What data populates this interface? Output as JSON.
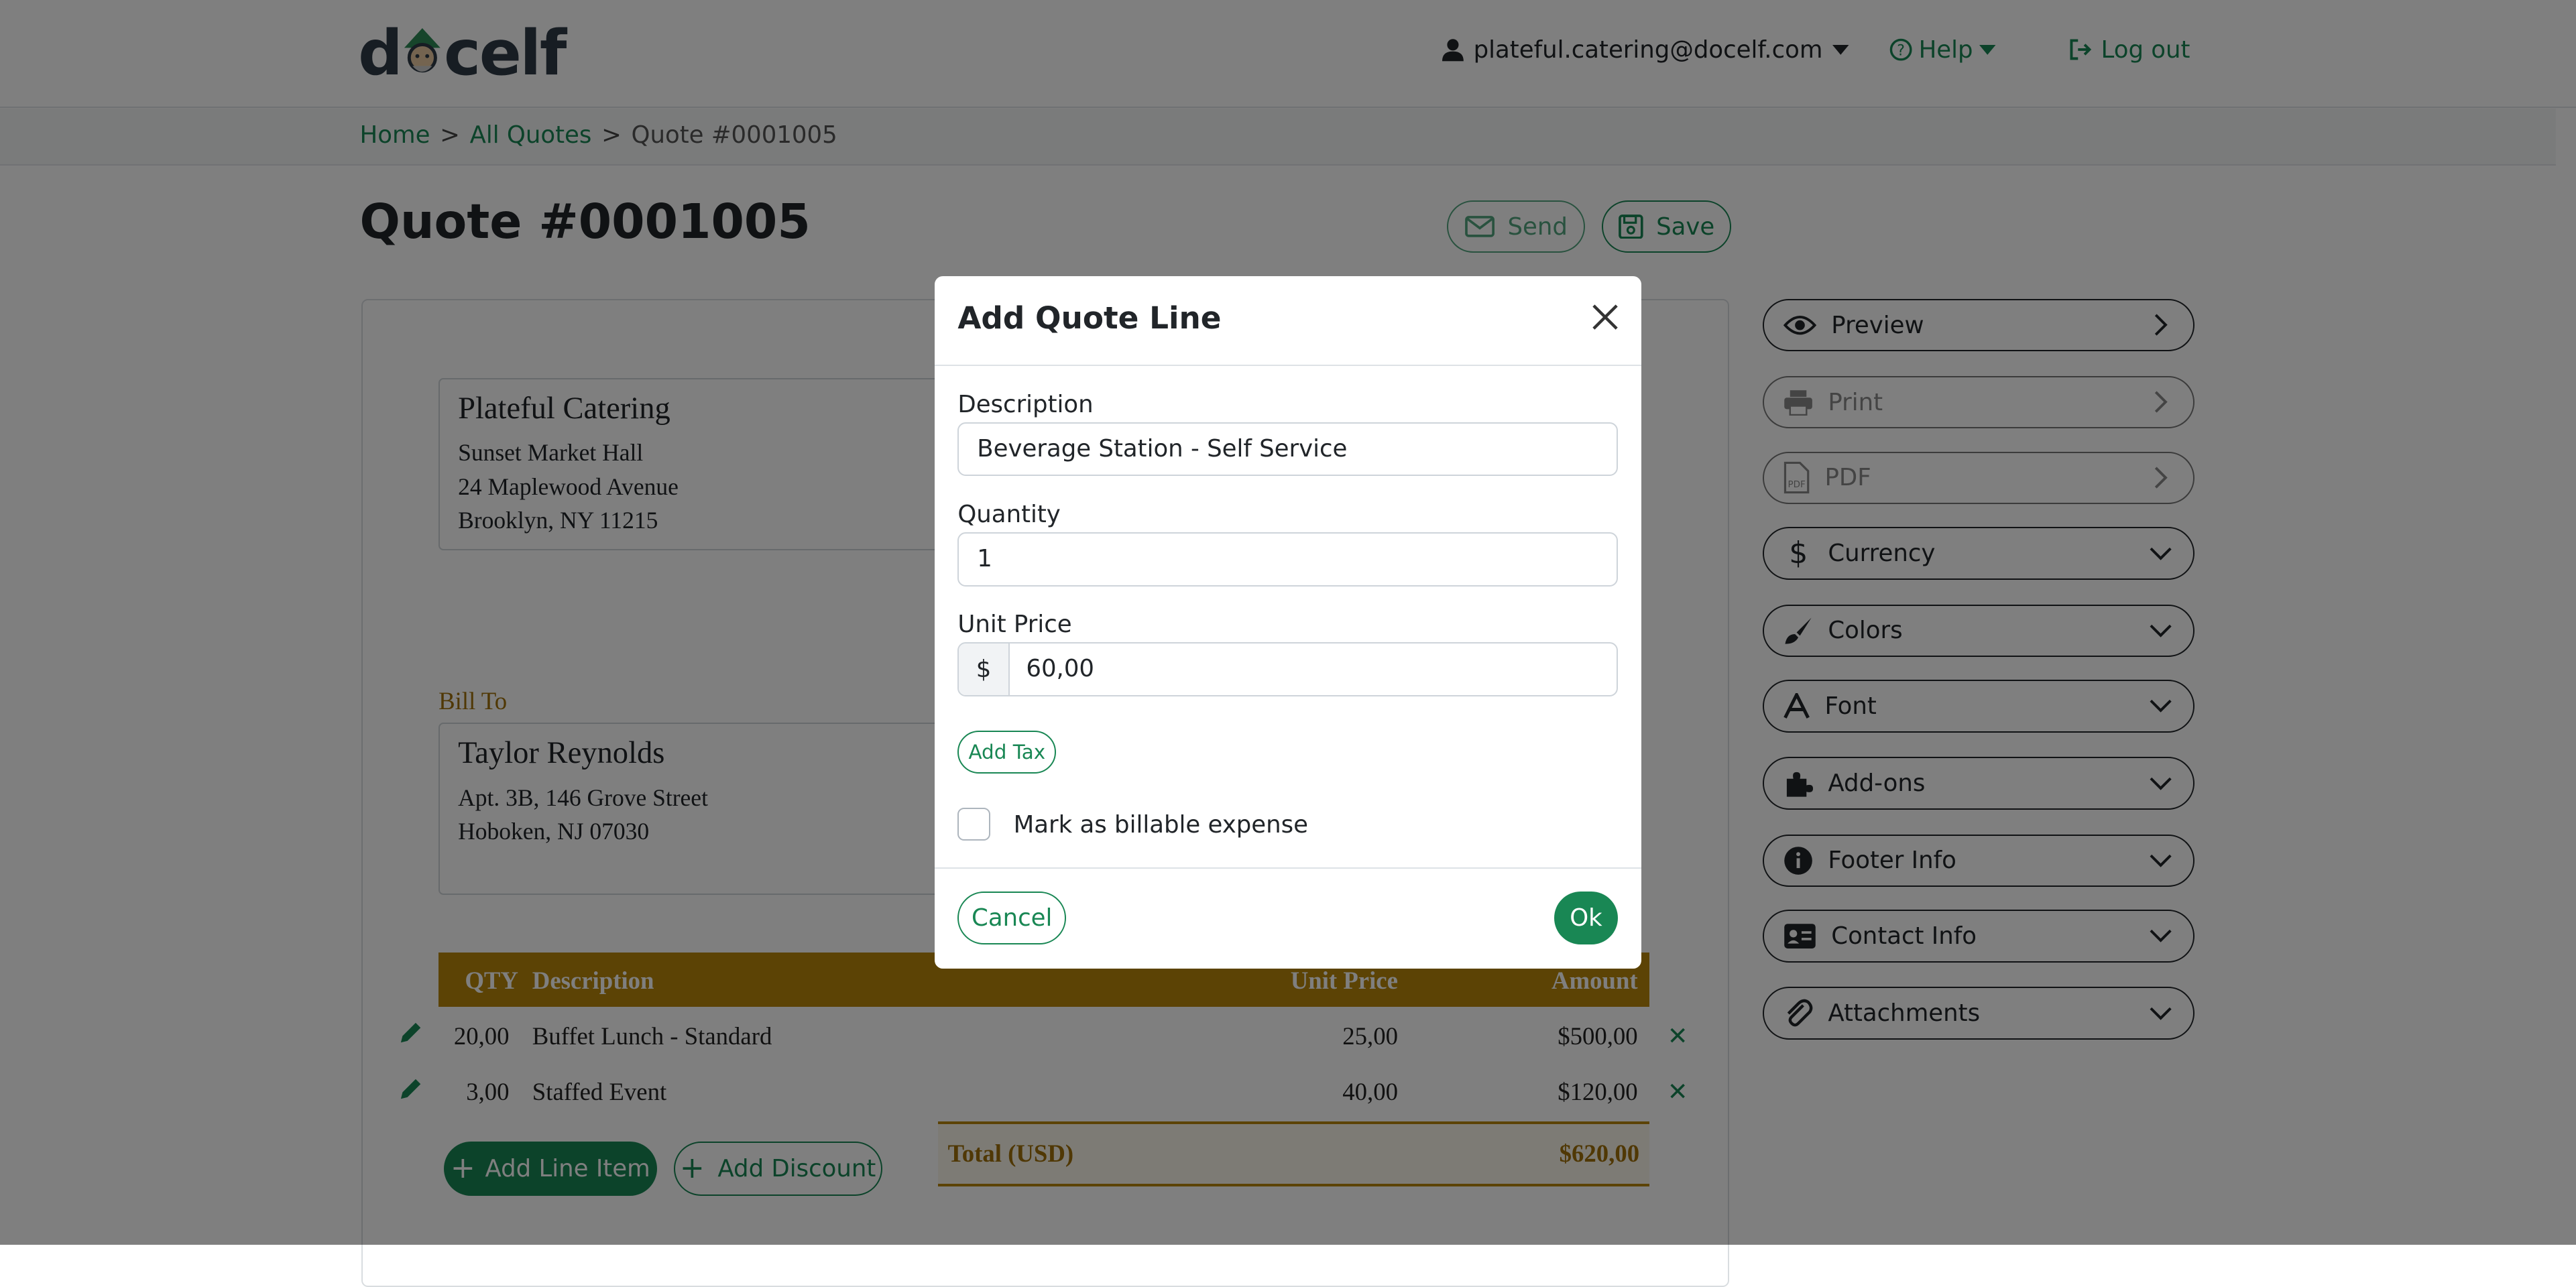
{
  "header": {
    "logo": "docelf",
    "user_email": "plateful.catering@docelf.com",
    "help": "Help",
    "logout": "Log out"
  },
  "breadcrumb": {
    "home": "Home",
    "all_quotes": "All Quotes",
    "current": "Quote #0001005",
    "sep": ">"
  },
  "page": {
    "title": "Quote #0001005",
    "send": "Send",
    "save": "Save"
  },
  "sender": {
    "name": "Plateful Catering",
    "lines": [
      "Sunset Market Hall",
      "24 Maplewood Avenue",
      "Brooklyn, NY 11215"
    ]
  },
  "bill_to": {
    "label": "Bill To",
    "name": "Taylor Reynolds",
    "lines": [
      "Apt. 3B, 146 Grove Street",
      "Hoboken, NJ 07030"
    ]
  },
  "table": {
    "headers": {
      "qty": "QTY",
      "description": "Description",
      "unit_price": "Unit Price",
      "amount": "Amount"
    },
    "rows": [
      {
        "qty": "20,00",
        "description": "Buffet Lunch - Standard",
        "unit_price": "25,00",
        "amount": "$500,00"
      },
      {
        "qty": "3,00",
        "description": "Staffed Event",
        "unit_price": "40,00",
        "amount": "$120,00"
      }
    ],
    "add_line_item": "Add Line Item",
    "add_discount": "Add Discount",
    "total_label": "Total (USD)",
    "total_value": "$620,00"
  },
  "sidebar": {
    "items": [
      {
        "label": "Preview",
        "icon": "eye-icon"
      },
      {
        "label": "Print",
        "icon": "printer-icon"
      },
      {
        "label": "PDF",
        "icon": "pdf-icon"
      },
      {
        "label": "Currency",
        "icon": "dollar-icon"
      },
      {
        "label": "Colors",
        "icon": "brush-icon"
      },
      {
        "label": "Font",
        "icon": "font-icon"
      },
      {
        "label": "Add-ons",
        "icon": "puzzle-icon"
      },
      {
        "label": "Footer Info",
        "icon": "info-icon"
      },
      {
        "label": "Contact Info",
        "icon": "contact-card-icon"
      },
      {
        "label": "Attachments",
        "icon": "paperclip-icon"
      }
    ]
  },
  "modal": {
    "title": "Add Quote Line",
    "description_label": "Description",
    "description_value": "Beverage Station - Self Service",
    "quantity_label": "Quantity",
    "quantity_value": "1",
    "unit_price_label": "Unit Price",
    "currency_symbol": "$",
    "unit_price_value": "60,00",
    "add_tax": "Add Tax",
    "billable_label": "Mark as billable expense",
    "billable_checked": false,
    "cancel": "Cancel",
    "ok": "Ok"
  },
  "colors": {
    "accent": "#198754",
    "gold": "#b8860b",
    "overlay": "rgba(0,0,0,0.5)"
  }
}
